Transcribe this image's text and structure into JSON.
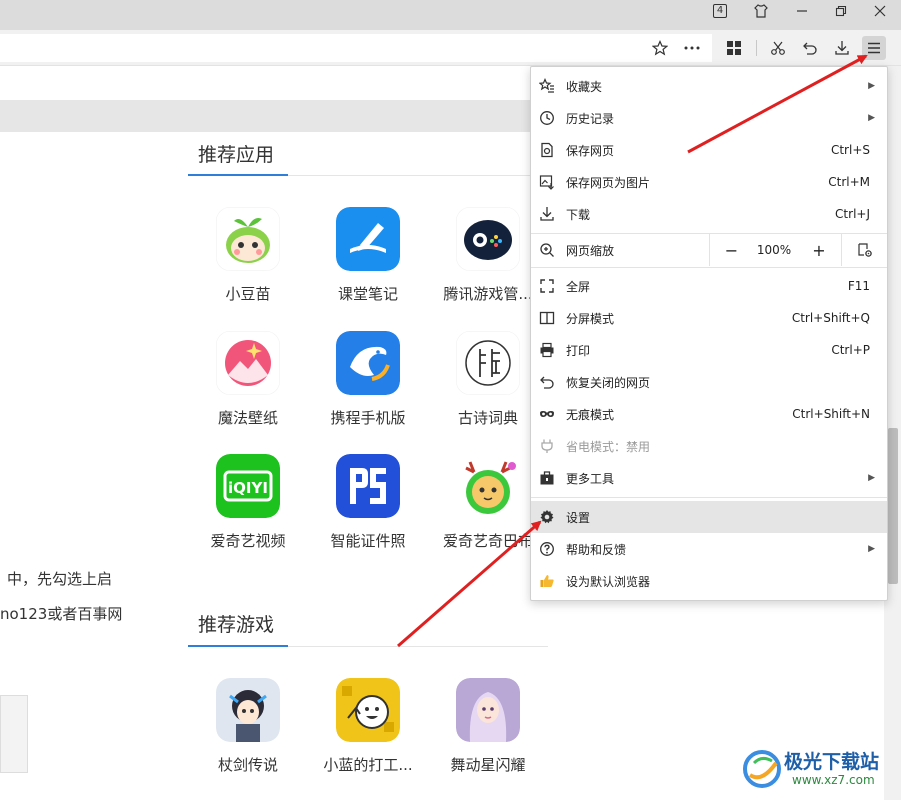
{
  "titlebar": {
    "badge": "4",
    "icons": [
      "tab-count-icon",
      "skin-icon",
      "minimize-icon",
      "restore-icon",
      "close-icon"
    ]
  },
  "toolbar": {
    "icons": [
      "star-icon",
      "more-icon",
      "apps-icon",
      "scissors-icon",
      "undo-icon",
      "download-icon",
      "menu-icon"
    ]
  },
  "recommended_apps": {
    "title": "推荐应用",
    "items": [
      {
        "name": "小豆苗",
        "icon": "xiaodoumiao-icon",
        "color": "#ffffff"
      },
      {
        "name": "课堂笔记",
        "icon": "ketangbiji-icon",
        "color": "#1b8ff0"
      },
      {
        "name": "腾讯游戏管...",
        "icon": "tencent-games-icon",
        "color": "#ffffff"
      },
      {
        "name": "魔法壁纸",
        "icon": "mofabizhi-icon",
        "color": "#ffffff"
      },
      {
        "name": "携程手机版",
        "icon": "ctrip-icon",
        "color": "#2480e8"
      },
      {
        "name": "古诗词典",
        "icon": "gushicidian-icon",
        "color": "#ffffff"
      },
      {
        "name": "爱奇艺视频",
        "icon": "iqiyi-icon",
        "color": "#1ec21e"
      },
      {
        "name": "智能证件照",
        "icon": "id-photo-icon",
        "color": "#2350d8"
      },
      {
        "name": "爱奇艺奇巴布",
        "icon": "qibabu-icon",
        "color": "#ffffff"
      }
    ]
  },
  "recommended_games": {
    "title": "推荐游戏",
    "items": [
      {
        "name": "杖剑传说",
        "icon": "zhangjian-icon"
      },
      {
        "name": "小蓝的打工...",
        "icon": "xiaolan-icon"
      },
      {
        "name": "舞动星闪耀",
        "icon": "wudong-icon"
      }
    ]
  },
  "body_text": {
    "line1": "中，先勾选上启",
    "line2": "no123或者百事网"
  },
  "menu": {
    "items": [
      {
        "label": "收藏夹",
        "shortcut": "",
        "arrow": true,
        "icon": "favorites-icon"
      },
      {
        "label": "历史记录",
        "shortcut": "",
        "arrow": true,
        "icon": "history-icon"
      },
      {
        "label": "保存网页",
        "shortcut": "Ctrl+S",
        "arrow": false,
        "icon": "save-page-icon"
      },
      {
        "label": "保存网页为图片",
        "shortcut": "Ctrl+M",
        "arrow": false,
        "icon": "save-image-icon"
      },
      {
        "label": "下载",
        "shortcut": "Ctrl+J",
        "arrow": false,
        "icon": "download-icon"
      }
    ],
    "zoom": {
      "label": "网页缩放",
      "minus": "−",
      "value": "100%",
      "plus": "+",
      "icon": "zoom-icon"
    },
    "items2": [
      {
        "label": "全屏",
        "shortcut": "F11",
        "arrow": false,
        "icon": "fullscreen-icon"
      },
      {
        "label": "分屏模式",
        "shortcut": "Ctrl+Shift+Q",
        "arrow": false,
        "icon": "split-screen-icon"
      },
      {
        "label": "打印",
        "shortcut": "Ctrl+P",
        "arrow": false,
        "icon": "print-icon"
      },
      {
        "label": "恢复关闭的网页",
        "shortcut": "",
        "arrow": false,
        "icon": "restore-tab-icon"
      },
      {
        "label": "无痕模式",
        "shortcut": "Ctrl+Shift+N",
        "arrow": false,
        "icon": "incognito-icon"
      },
      {
        "label": "省电模式：禁用",
        "shortcut": "",
        "arrow": false,
        "icon": "power-save-icon",
        "disabled": true
      },
      {
        "label": "更多工具",
        "shortcut": "",
        "arrow": true,
        "icon": "toolbox-icon"
      }
    ],
    "items3": [
      {
        "label": "设置",
        "shortcut": "",
        "arrow": false,
        "icon": "gear-icon",
        "hover": true
      },
      {
        "label": "帮助和反馈",
        "shortcut": "",
        "arrow": true,
        "icon": "help-icon"
      },
      {
        "label": "设为默认浏览器",
        "shortcut": "",
        "arrow": false,
        "icon": "thumbs-up-icon"
      }
    ]
  },
  "watermark": {
    "main": "极光下载站",
    "sub": "www.xz7.com"
  },
  "colors": {
    "accent": "#2f7fd8",
    "arrow": "#e02020",
    "menu_hover": "#e5e5e5"
  }
}
